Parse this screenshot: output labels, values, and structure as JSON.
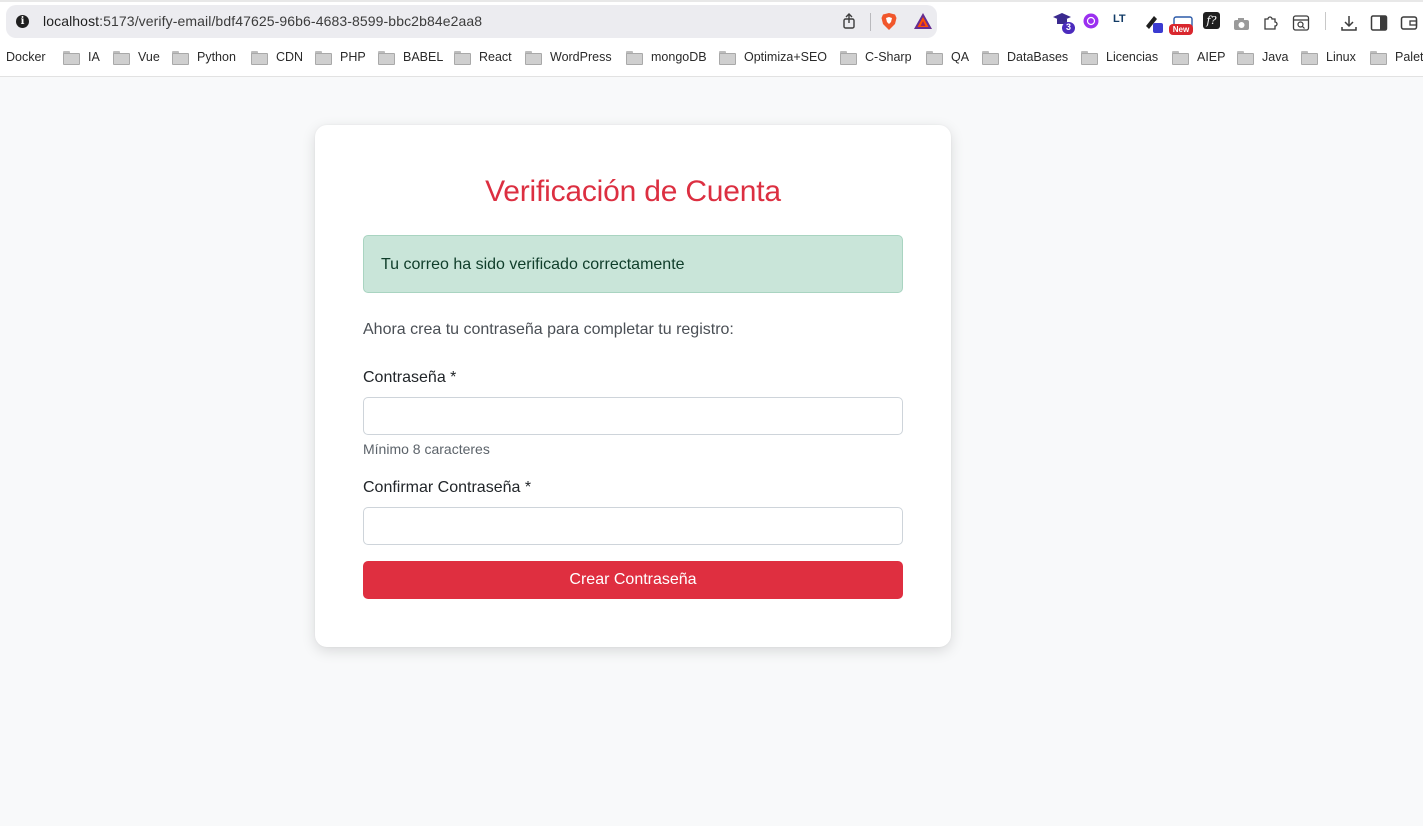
{
  "browser": {
    "url_host": "localhost",
    "url_path": ":5173/verify-email/bdf47625-96b6-4683-8599-bbc2b84e2aa8",
    "extensions": [
      {
        "name": "graduation-cap-extension",
        "badge": "3"
      },
      {
        "name": "purple-circle-extension"
      },
      {
        "name": "languagetool-extension",
        "label": "LT"
      },
      {
        "name": "pen-extension"
      },
      {
        "name": "new-badge-extension",
        "badge": "New"
      },
      {
        "name": "function-extension",
        "label": "f?"
      },
      {
        "name": "camera-extension"
      },
      {
        "name": "puzzle-extension"
      },
      {
        "name": "tab-search-extension"
      },
      {
        "name": "download-extension"
      },
      {
        "name": "sidebar-extension"
      },
      {
        "name": "wallet-extension"
      }
    ],
    "bookmarks": [
      "Docker",
      "IA",
      "Vue",
      "Python",
      "CDN",
      "PHP",
      "BABEL",
      "React",
      "WordPress",
      "mongoDB",
      "Optimiza+SEO",
      "C-Sharp",
      "QA",
      "DataBases",
      "Licencias",
      "AIEP",
      "Java",
      "Linux",
      "Paleta"
    ]
  },
  "page": {
    "title": "Verificación de Cuenta",
    "success_message": "Tu correo ha sido verificado correctamente",
    "lead": "Ahora crea tu contraseña para completar tu registro:",
    "password_label": "Contraseña *",
    "password_value": "",
    "password_hint": "Mínimo 8 caracteres",
    "confirm_label": "Confirmar Contraseña *",
    "confirm_value": "",
    "submit_label": "Crear Contraseña"
  },
  "colors": {
    "accent": "#dc2f41",
    "button": "#df2f40",
    "alert_bg": "#c9e5d9",
    "alert_border": "#a9d4c1",
    "page_bg": "#f8f9fa"
  }
}
